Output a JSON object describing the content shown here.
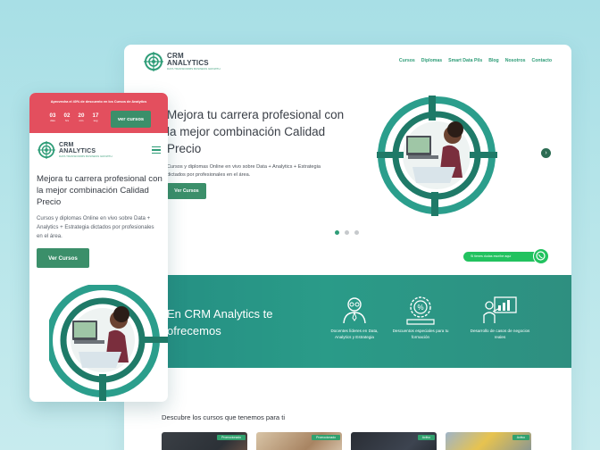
{
  "brand": {
    "name_line1": "CRM",
    "name_line2": "ANALYTICS",
    "tagline": "DATA TRANSFORMS BUSINESS GROWTH"
  },
  "colors": {
    "accent_green": "#2f9d78",
    "button_green": "#3b8f6a",
    "promo_red": "#e34f5e",
    "band_teal": "#2a9b88",
    "whatsapp_green": "#22c25f"
  },
  "desktop": {
    "nav": [
      "Cursos",
      "Diplomas",
      "Smart Data Pils",
      "Blog",
      "Nosotros",
      "Contacto"
    ],
    "hero": {
      "title": "Mejora tu carrera profesional con la mejor combinación Calidad Precio",
      "subtitle": "Cursos y diplomas Online en vivo sobre Data + Analytics + Estrategia dictados por profesionales en el área.",
      "button": "Ver Cursos",
      "next_icon": "chevron-right-icon",
      "slides": 3,
      "active_slide": 1
    },
    "whatsapp": {
      "text": "Si tienes dudas escríbe aquí",
      "icon": "whatsapp-icon"
    },
    "band": {
      "title": "En CRM Analytics te ofrecemos",
      "features": [
        {
          "icon": "teacher-icon",
          "label": "Docentes líderes en Data, Analytics y Estrategia"
        },
        {
          "icon": "discount-badge-icon",
          "label": "Descuentos especiales para tu formación"
        },
        {
          "icon": "presentation-icon",
          "label": "Desarrollo de casos de negocios reales"
        }
      ]
    },
    "courses": {
      "title": "Descubre los cursos que tenemos para ti",
      "cards": [
        {
          "tag": "Promocionado"
        },
        {
          "tag": "Promocionado"
        },
        {
          "tag": "Activo"
        },
        {
          "tag": "Activo"
        }
      ]
    }
  },
  "mobile": {
    "banner": {
      "text": "Aprovecha el 40% de descuento en los Cursos de Analytics",
      "countdown": [
        {
          "value": "03",
          "unit": "días"
        },
        {
          "value": "02",
          "unit": "hrs"
        },
        {
          "value": "20",
          "unit": "min"
        },
        {
          "value": "17",
          "unit": "seg"
        }
      ],
      "button": "ver cursos"
    },
    "menu_icon": "hamburger-icon",
    "hero": {
      "title": "Mejora tu carrera profesional con la mejor combinación Calidad Precio",
      "subtitle": "Cursos y diplomas Online en vivo sobre Data + Analytics + Estrategia dictados por profesionales en el área.",
      "button": "Ver Cursos"
    }
  }
}
